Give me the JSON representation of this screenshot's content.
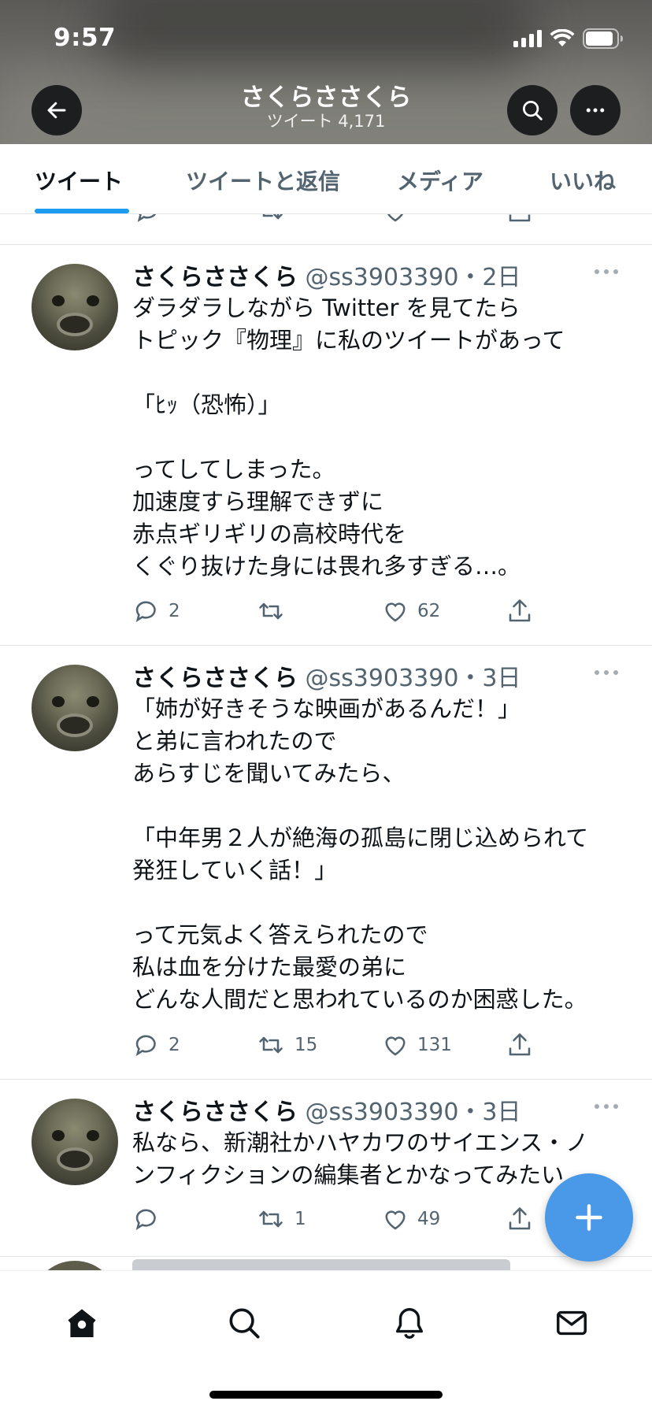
{
  "status_bar": {
    "time": "9:57"
  },
  "header": {
    "title": "さくらささくら",
    "subtitle": "ツイート 4,171"
  },
  "tabs": [
    {
      "label": "ツイート",
      "active": true
    },
    {
      "label": "ツイートと返信",
      "active": false
    },
    {
      "label": "メディア",
      "active": false
    },
    {
      "label": "いいね",
      "active": false
    }
  ],
  "tweets": [
    {
      "name": "さくらささくら",
      "handle": "@ss3903390",
      "time": "・2日",
      "text": "ダラダラしながら Twitter を見てたら\nトピック『物理』に私のツイートがあって\n\n「ﾋｯ（恐怖）」\n\nってしてしまった。\n加速度すら理解できずに\n赤点ギリギリの高校時代を\nくぐり抜けた身には畏れ多すぎる…。",
      "replies": "2",
      "retweets": "",
      "likes": "62"
    },
    {
      "name": "さくらささくら",
      "handle": "@ss3903390",
      "time": "・3日",
      "text": "「姉が好きそうな映画があるんだ！」\nと弟に言われたので\nあらすじを聞いてみたら、\n\n「中年男２人が絶海の孤島に閉じ込められて\n発狂していく話！」\n\nって元気よく答えられたので\n私は血を分けた最愛の弟に\nどんな人間だと思われているのか困惑した。",
      "replies": "2",
      "retweets": "15",
      "likes": "131"
    },
    {
      "name": "さくらささくら",
      "handle": "@ss3903390",
      "time": "・3日",
      "text": "私なら、新潮社かハヤカワのサイエンス・ノ\nンフィクションの編集者とかなってみたい",
      "replies": "",
      "retweets": "1",
      "likes": "49"
    }
  ],
  "icons": {
    "back": "arrow-left-icon",
    "search": "search-icon",
    "more": "more-icon",
    "reply": "reply-icon",
    "retweet": "retweet-icon",
    "like": "heart-icon",
    "share": "share-icon",
    "compose": "plus-icon",
    "home": "home-icon",
    "explore": "search-icon",
    "notifications": "bell-icon",
    "messages": "mail-icon"
  },
  "colors": {
    "accent": "#1d9bf0",
    "fab": "#4a99e9",
    "text": "#0f1419",
    "muted": "#536471"
  }
}
